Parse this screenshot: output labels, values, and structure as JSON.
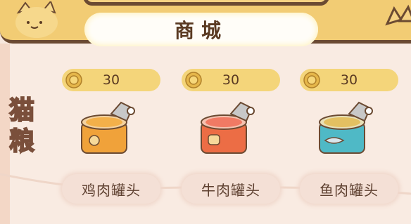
{
  "shop": {
    "title": "商城",
    "category_label": [
      "猫",
      "粮"
    ]
  },
  "items": [
    {
      "name": "鸡肉罐头",
      "price": "30",
      "can_color": "#f0a23a",
      "icon": "chicken-can-icon"
    },
    {
      "name": "牛肉罐头",
      "price": "30",
      "can_color": "#ec6d45",
      "icon": "beef-can-icon"
    },
    {
      "name": "鱼肉罐头",
      "price": "30",
      "can_color": "#4fb9c6",
      "icon": "fish-can-icon"
    }
  ],
  "colors": {
    "header": "#f2cc74",
    "border": "#6b4a32",
    "background": "#f9ebe2",
    "price_pill": "#f4d57a"
  }
}
